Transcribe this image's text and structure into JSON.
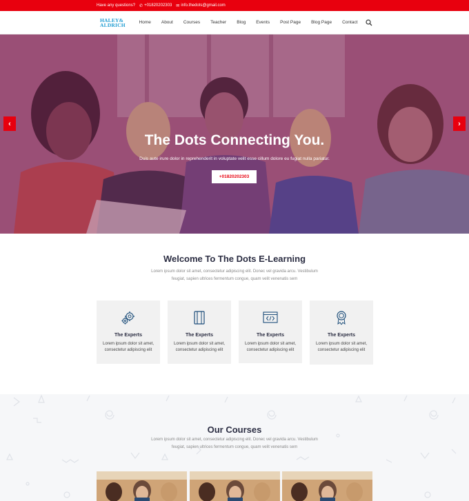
{
  "topbar": {
    "question": "Have any questions?",
    "phone": "+01820202303",
    "email": "info.thedots@gmail.com"
  },
  "logo": {
    "line1": "HALEY&",
    "line2": "ALDRICH"
  },
  "nav": {
    "items": [
      "Home",
      "About",
      "Courses",
      "Teacher",
      "Blog",
      "Events",
      "Post Page",
      "Blog Page",
      "Contact"
    ]
  },
  "hero": {
    "title": "The Dots Connecting You.",
    "subtitle": "Duis aute irure dolor in reprehenderit in voluptate velit esse cillum dolore eu fugiat nulla pariatur.",
    "cta": "+01820202303"
  },
  "welcome": {
    "title": "Welcome To The Dots E-Learning",
    "line1": "Lorem ipsum dolor sit amet, consectetur adipiscing elit. Donec vel gravida arcu. Vestibulum",
    "line2": "feugiat, sapien ultrices fermentum congue, quam velit venenatis sem"
  },
  "features": [
    {
      "icon": "gears-icon",
      "title": "The Experts",
      "line1": "Lorem ipsum dolor sit amet,",
      "line2": "consectetur adipiscing elit"
    },
    {
      "icon": "book-icon",
      "title": "The Experts",
      "line1": "Lorem ipsum dolor sit amet,",
      "line2": "consectetur adipiscing elit"
    },
    {
      "icon": "code-window-icon",
      "title": "The Experts",
      "line1": "Lorem ipsum dolor sit amet,",
      "line2": "consectetur adipiscing elit"
    },
    {
      "icon": "award-icon",
      "title": "The Experts",
      "line1": "Lorem ipsum dolor sit amet,",
      "line2": "consectetur adipiscing elit"
    }
  ],
  "courses": {
    "title": "Our Courses",
    "line1": "Lorem ipsum dolor sit amet, consectetur adipiscing elit. Donec vel gravida arcu. Vestibulum",
    "line2": "feugiat, sapien ultrices fermentum congue, quam velit venenatis sem"
  },
  "colors": {
    "accent": "#e8000e",
    "heading": "#2b2d42",
    "icon": "#1d4e7a"
  }
}
